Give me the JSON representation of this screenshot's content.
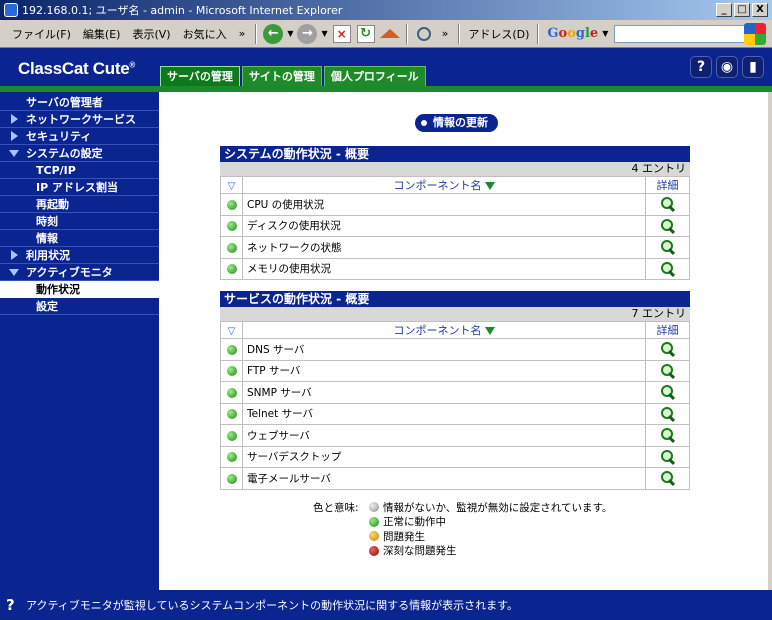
{
  "window": {
    "title": "192.168.0.1; ユーザ名 - admin - Microsoft Internet Explorer",
    "buttons": [
      "_",
      "□",
      "X"
    ]
  },
  "toolbar": {
    "menus": [
      "ファイル(F)",
      "編集(E)",
      "表示(V)",
      "お気に入"
    ],
    "chevron": "»",
    "address_label": "アドレス(D)",
    "search_value": ""
  },
  "app": {
    "brand": "ClassCat Cute",
    "brand_mark": "®",
    "tabs": [
      "サーバの管理",
      "サイトの管理",
      "個人プロフィール"
    ],
    "header_icons": [
      "help-icon",
      "view-icon",
      "logout-icon"
    ]
  },
  "sidebar": {
    "items": [
      {
        "label": "サーバの管理者",
        "type": "head"
      },
      {
        "label": "ネットワークサービス",
        "type": "collapsed"
      },
      {
        "label": "セキュリティ",
        "type": "collapsed"
      },
      {
        "label": "システムの設定",
        "type": "expanded"
      },
      {
        "label": "TCP/IP",
        "type": "sub"
      },
      {
        "label": "IP アドレス割当",
        "type": "sub"
      },
      {
        "label": "再起動",
        "type": "sub"
      },
      {
        "label": "時刻",
        "type": "sub"
      },
      {
        "label": "情報",
        "type": "sub"
      },
      {
        "label": "利用状況",
        "type": "collapsed"
      },
      {
        "label": "アクティブモニタ",
        "type": "expanded"
      },
      {
        "label": "動作状況",
        "type": "sub-selected"
      },
      {
        "label": "設定",
        "type": "sub"
      }
    ]
  },
  "main": {
    "refresh_button": "情報の更新",
    "system_table": {
      "caption": "システムの動作状況 - 概要",
      "count": "4 エントリ",
      "col_component": "コンポーネント名",
      "col_detail": "詳細",
      "rows": [
        "CPU の使用状況",
        "ディスクの使用状況",
        "ネットワークの状態",
        "メモリの使用状況"
      ]
    },
    "service_table": {
      "caption": "サービスの動作状況 - 概要",
      "count": "7 エントリ",
      "col_component": "コンポーネント名",
      "col_detail": "詳細",
      "rows": [
        "DNS サーバ",
        "FTP サーバ",
        "SNMP サーバ",
        "Telnet サーバ",
        "ウェブサーバ",
        "サーバデスクトップ",
        "電子メールサーバ"
      ]
    },
    "legend": {
      "label": "色と意味:",
      "items": [
        {
          "text": "情報がないか、監視が無効に設定されています。",
          "color": "#9a9a9a"
        },
        {
          "text": "正常に動作中",
          "color": "#1a8a10"
        },
        {
          "text": "問題発生",
          "color": "#e09000"
        },
        {
          "text": "深刻な問題発生",
          "color": "#b01010"
        }
      ]
    }
  },
  "status": {
    "text": "アクティブモニタが監視しているシステムコンポーネントの動作状況に関する情報が表示されます。"
  }
}
